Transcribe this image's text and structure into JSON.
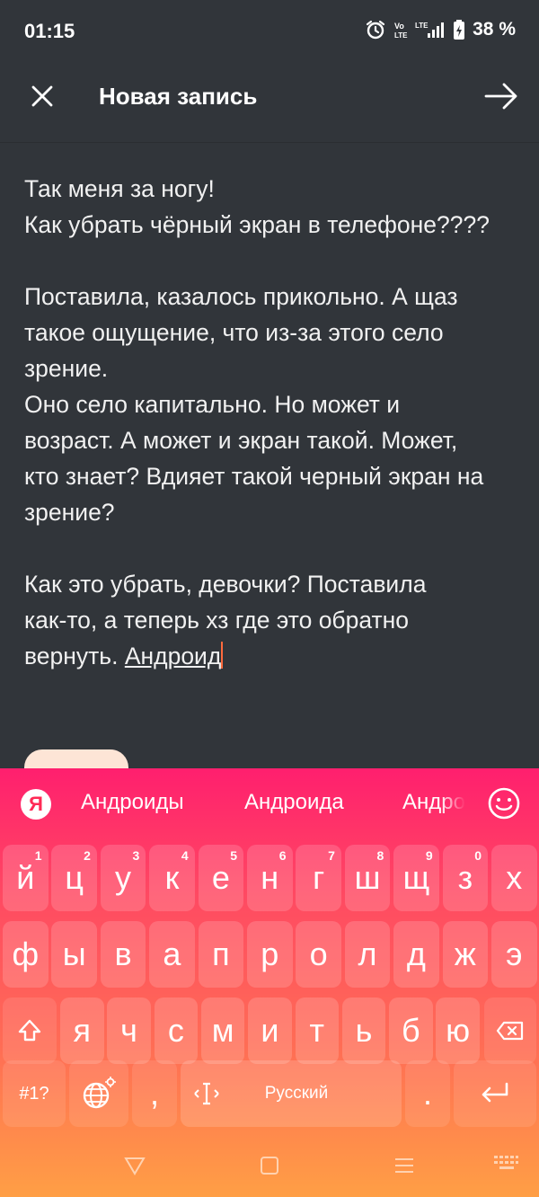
{
  "status_bar": {
    "time": "01:15",
    "battery": "38 %"
  },
  "header": {
    "title": "Новая запись"
  },
  "editor": {
    "lines": [
      "Так меня за ногу!",
      "Как убрать чёрный экран в телефоне????",
      "",
      "Поставила, казалось прикольно. А щаз",
      "такое ощущение, что из-за этого село",
      "зрение.",
      "Оно село капитально. Но может и",
      "возраст. А может и экран такой. Может,",
      "кто знает? Вдияет такой черный экран на",
      "зрение?",
      "",
      "Как это убрать, девочки? Поставила",
      "как-то, а теперь хз где это обратно"
    ],
    "last_line_prefix": "вернуть. ",
    "last_word": "Андроид"
  },
  "keyboard": {
    "logo": "Я",
    "suggestions": [
      "Андроиды",
      "Андроида",
      "Андро"
    ],
    "row1": [
      "й",
      "ц",
      "у",
      "к",
      "е",
      "н",
      "г",
      "ш",
      "щ",
      "з",
      "х"
    ],
    "row1_nums": [
      "1",
      "2",
      "3",
      "4",
      "5",
      "6",
      "7",
      "8",
      "9",
      "0"
    ],
    "row2": [
      "ф",
      "ы",
      "в",
      "а",
      "п",
      "р",
      "о",
      "л",
      "д",
      "ж",
      "э"
    ],
    "row3": [
      "я",
      "ч",
      "с",
      "м",
      "и",
      "т",
      "ь",
      "б",
      "ю"
    ],
    "symbols_label": "#1?",
    "comma": ",",
    "space_label": "Русский",
    "period": ".",
    "colors": {
      "top": "#ff1f6e",
      "bottom": "#ff9f45"
    }
  }
}
